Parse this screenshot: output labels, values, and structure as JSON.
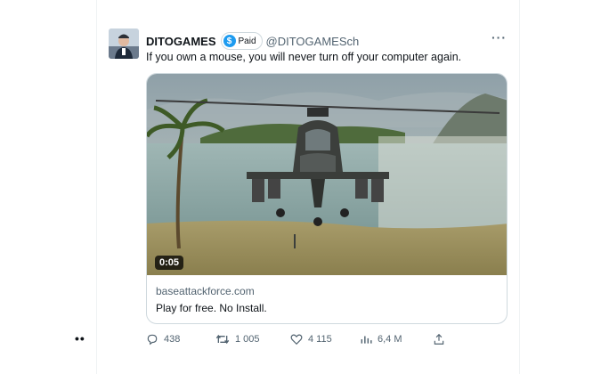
{
  "tweet": {
    "author_name": "DITOGAMES",
    "badge_label": "Paid",
    "handle": "@DITOGAMESch",
    "text": "If you own a mouse, you will never turn off your computer again.",
    "more_icon": "more-horizontal-icon"
  },
  "card": {
    "video_duration": "0:05",
    "domain": "baseattackforce.com",
    "title": "Play for free. No Install."
  },
  "actions": {
    "replies": "438",
    "retweets": "1 005",
    "likes": "4 115",
    "views": "6,4 M"
  },
  "colors": {
    "accent": "#1d9bf0",
    "secondary_text": "#536471",
    "border": "#cfd9de"
  }
}
